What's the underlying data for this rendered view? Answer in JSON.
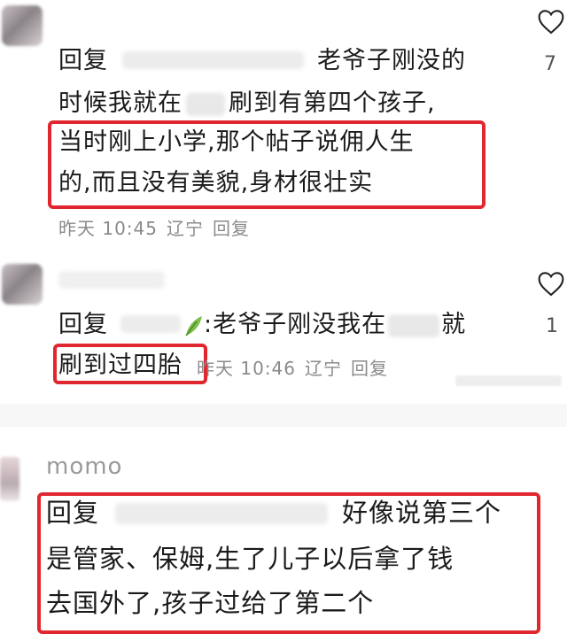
{
  "comments": [
    {
      "reply_prefix": "回复",
      "lines": [
        "老爷子刚没的",
        "时候我就在",
        "刷到有第四个孩子,",
        "当时刚上小学,那个帖子说佣人生",
        "的,而且没有美貌,身材很壮实"
      ],
      "time": "昨天 10:45",
      "location": "辽宁",
      "reply_label": "回复",
      "likes": "7"
    },
    {
      "reply_prefix": "回复",
      "line1_a": ":老爷子刚没我在",
      "line1_b": "就",
      "line2": "刷到过四胎",
      "time": "昨天 10:46",
      "location": "辽宁",
      "reply_label": "回复",
      "likes": "1"
    },
    {
      "username": "momo",
      "reply_prefix": "回复",
      "lines": [
        "好像说第三个",
        "是管家、保姆,生了儿子以后拿了钱",
        "去国外了,孩子过给了第二个"
      ]
    }
  ],
  "colors": {
    "highlight": "#e0262e",
    "meta_text": "#8a8a8a"
  },
  "icons": [
    "heart-outline-icon",
    "leaf-icon"
  ]
}
